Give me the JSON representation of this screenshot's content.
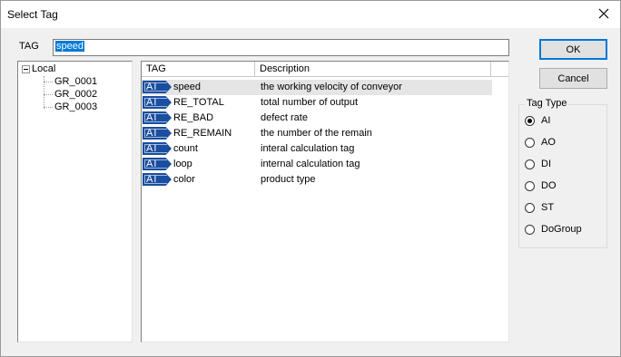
{
  "window": {
    "title": "Select Tag"
  },
  "tag": {
    "label": "TAG",
    "value": "speed"
  },
  "buttons": {
    "ok": "OK",
    "cancel": "Cancel"
  },
  "tree": {
    "root": "Local",
    "children": [
      "GR_0001",
      "GR_0002",
      "GR_0003"
    ]
  },
  "list": {
    "headers": {
      "tag": "TAG",
      "description": "Description"
    },
    "rows": [
      {
        "type": "AI",
        "tag": "speed",
        "description": "the working velocity of conveyor"
      },
      {
        "type": "AI",
        "tag": "RE_TOTAL",
        "description": "total number of output"
      },
      {
        "type": "AI",
        "tag": "RE_BAD",
        "description": "defect rate"
      },
      {
        "type": "AI",
        "tag": "RE_REMAIN",
        "description": "the number of the remain"
      },
      {
        "type": "AI",
        "tag": "count",
        "description": "interal calculation tag"
      },
      {
        "type": "AI",
        "tag": "loop",
        "description": "internal calculation tag"
      },
      {
        "type": "AI",
        "tag": "color",
        "description": "product type"
      }
    ]
  },
  "tag_type": {
    "label": "Tag Type",
    "options": [
      "AI",
      "AO",
      "DI",
      "DO",
      "ST",
      "DoGroup"
    ],
    "selected": "AI"
  },
  "colors": {
    "badge": "#1a4ea0",
    "selection": "#0078d7"
  },
  "icons": {
    "close": "close-icon",
    "tree_expander": "minus-expander-icon"
  }
}
